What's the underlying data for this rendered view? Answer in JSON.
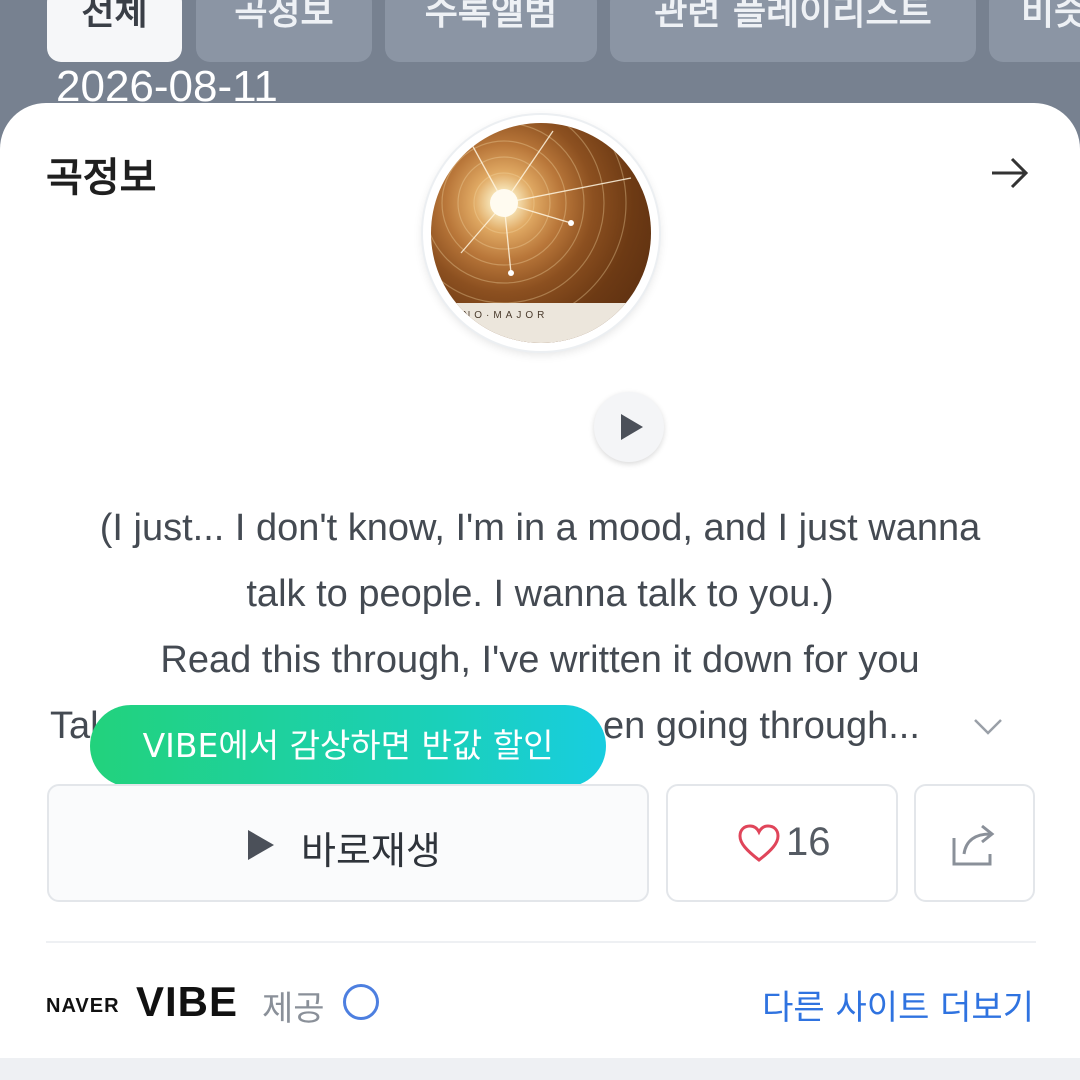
{
  "tabs": [
    {
      "label": "전체",
      "active": true
    },
    {
      "label": "곡정보",
      "active": false
    },
    {
      "label": "수록앨범",
      "active": false
    },
    {
      "label": "관련 플레이리스트",
      "active": false
    },
    {
      "label": "비슷",
      "active": false
    }
  ],
  "date_overlay": "2026-08-11",
  "card": {
    "title": "곡정보",
    "album_label": "NO·MAJOR",
    "lyrics": [
      "(I just... I don't know, I'm in a mood, and I just wanna",
      "talk to people. I wanna talk to you.)",
      "Read this through, I've written it down for you",
      "Tal",
      "en going through..."
    ],
    "promo": "VIBE에서 감상하면 반값 할인",
    "play_label": "바로재생",
    "like_count": "16",
    "footer": {
      "brand_naver": "NAVER",
      "brand_vibe": "VIBE",
      "provided": "제공",
      "more_sites": "다른 사이트 더보기"
    }
  },
  "colors": {
    "background": "#778190",
    "promo_start": "#22d27c",
    "promo_end": "#18cde0",
    "link": "#2f73e0",
    "heart": "#e0455a"
  },
  "icons": [
    "arrow-right-icon",
    "play-icon",
    "chevron-down-icon",
    "heart-icon",
    "share-icon",
    "info-icon"
  ]
}
